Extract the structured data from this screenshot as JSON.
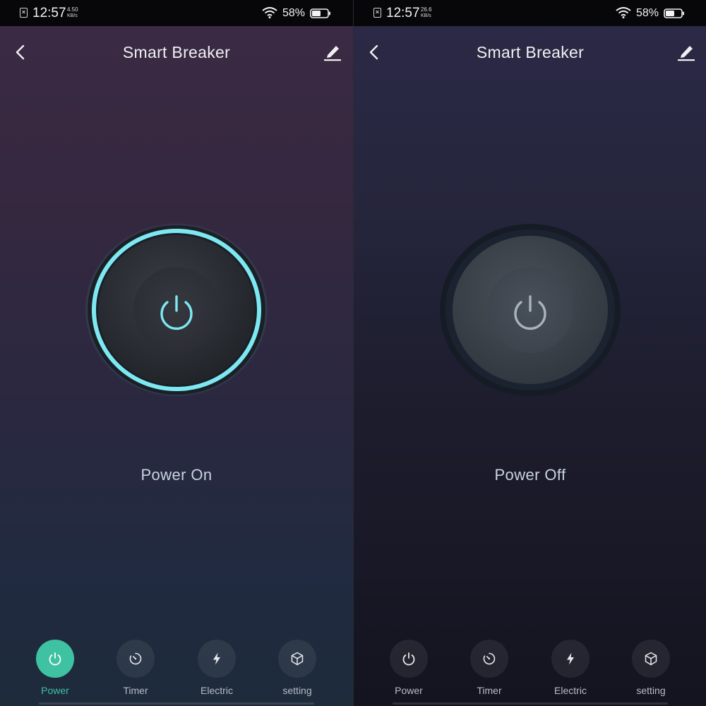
{
  "screens": [
    {
      "status": {
        "sim_icon": "sim-off-icon",
        "time": "12:57",
        "speed_value": "4.50",
        "speed_unit": "KB/s",
        "battery_pct": "58%"
      },
      "header": {
        "title": "Smart Breaker",
        "back_icon": "back-arrow-icon",
        "edit_icon": "edit-pencil-icon"
      },
      "power_button": {
        "icon": "power-icon",
        "state": "on",
        "ring_color": "#6ee3ee"
      },
      "status_text": "Power On",
      "tabs": [
        {
          "label": "Power",
          "icon": "power-icon",
          "active": true
        },
        {
          "label": "Timer",
          "icon": "timer-icon",
          "active": false
        },
        {
          "label": "Electric",
          "icon": "lightning-icon",
          "active": false
        },
        {
          "label": "setting",
          "icon": "cube-icon",
          "active": false
        }
      ]
    },
    {
      "status": {
        "sim_icon": "sim-off-icon",
        "time": "12:57",
        "speed_value": "26.6",
        "speed_unit": "KB/s",
        "battery_pct": "58%"
      },
      "header": {
        "title": "Smart Breaker",
        "back_icon": "back-arrow-icon",
        "edit_icon": "edit-pencil-icon"
      },
      "power_button": {
        "icon": "power-icon",
        "state": "off",
        "ring_color": "#1b2230"
      },
      "status_text": "Power Off",
      "tabs": [
        {
          "label": "Power",
          "icon": "power-icon",
          "active": false
        },
        {
          "label": "Timer",
          "icon": "timer-icon",
          "active": false
        },
        {
          "label": "Electric",
          "icon": "lightning-icon",
          "active": false
        },
        {
          "label": "setting",
          "icon": "cube-icon",
          "active": false
        }
      ]
    }
  ],
  "colors": {
    "accent": "#3fc2a1",
    "glow": "#6ee3ee",
    "icon_off": "#aab2bb"
  }
}
